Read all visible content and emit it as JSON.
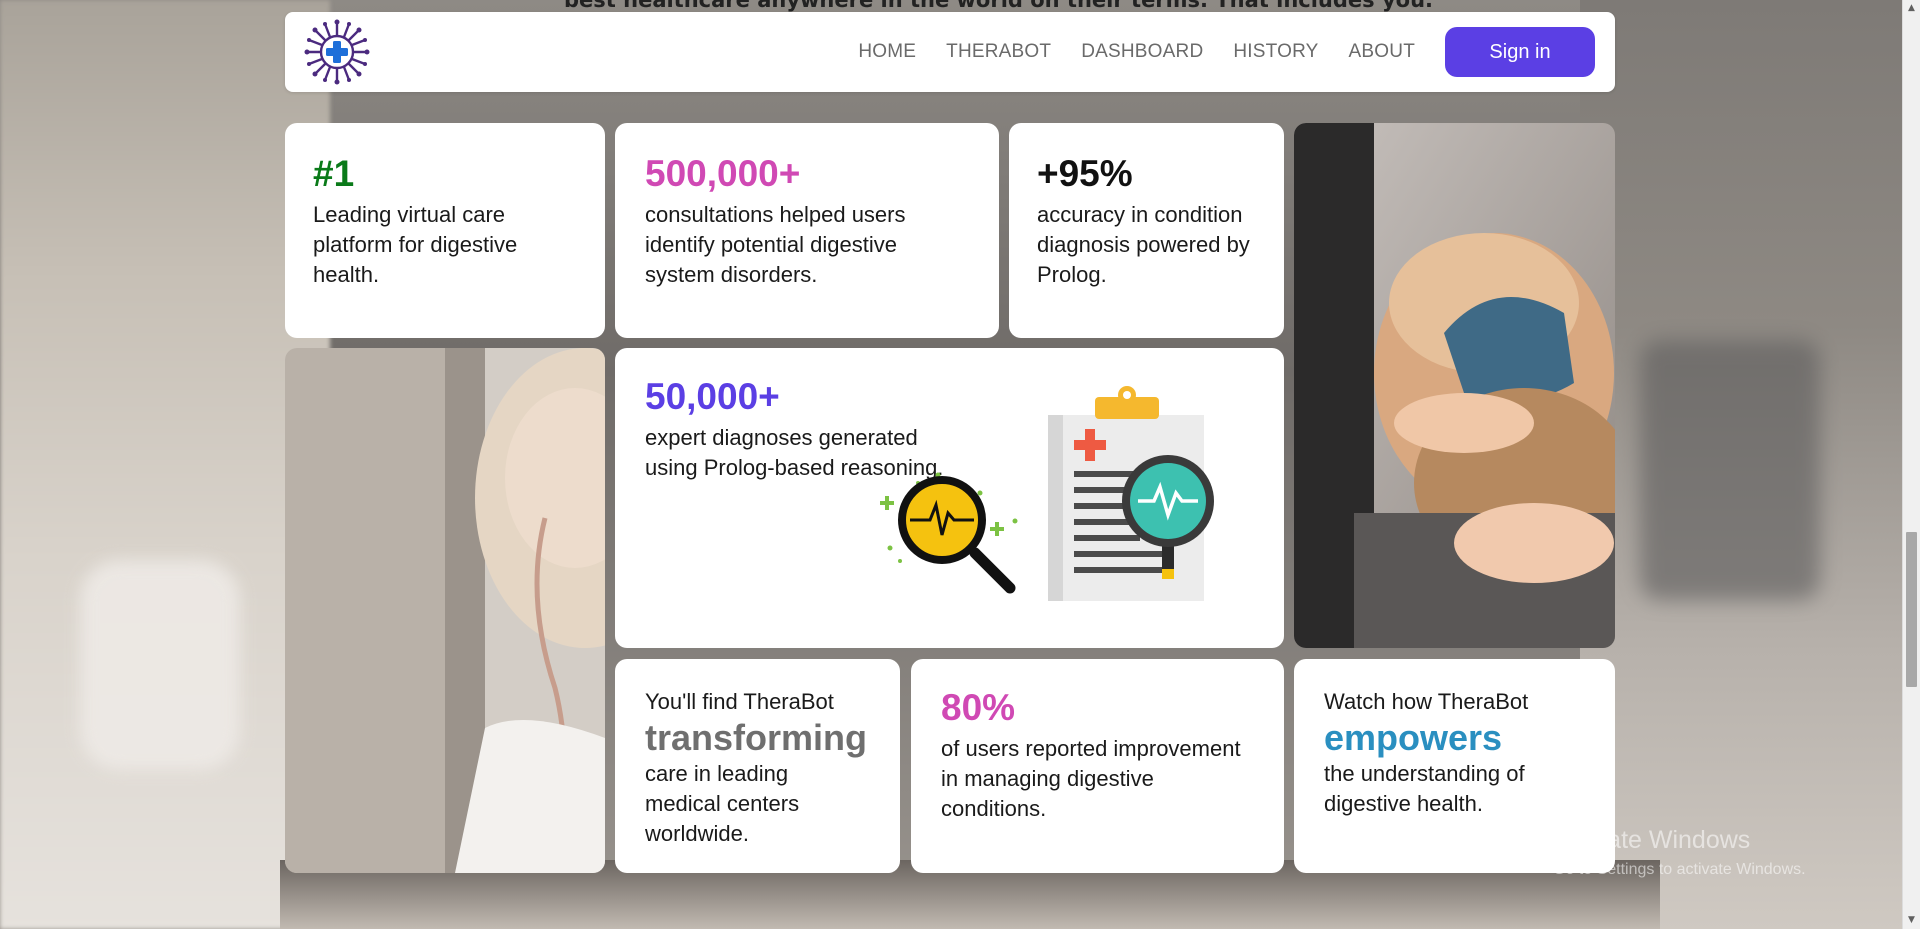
{
  "background_text": "best healthcare anywhere in the world on their terms. That includes you.",
  "nav": {
    "links": [
      "HOME",
      "THERABOT",
      "DASHBOARD",
      "HISTORY",
      "ABOUT"
    ],
    "signin_label": "Sign in",
    "accent": "#5b3fe4"
  },
  "stats": {
    "s1": {
      "value": "#1",
      "desc": "Leading virtual care platform for digestive health.",
      "color": "#0a7a19"
    },
    "s2": {
      "value": "500,000+",
      "desc": "consultations helped users identify potential digestive system disorders.",
      "color": "#d049b4"
    },
    "s3": {
      "value": "+95%",
      "desc": "accuracy in condition diagnosis powered by Prolog.",
      "color": "#111111"
    },
    "s4": {
      "value": "50,000+",
      "desc": "expert diagnoses generated using Prolog-based reasoning.",
      "color": "#5b3fe4"
    },
    "s5": {
      "intro": "You'll find TheraBot",
      "highlight": "transforming",
      "desc": "care in leading medical centers worldwide.",
      "color": "#6f6f6f"
    },
    "s6": {
      "value": "80%",
      "desc": "of users reported improvement in managing digestive conditions.",
      "color": "#d049b4"
    },
    "s7": {
      "intro": "Watch how TheraBot",
      "highlight": "empowers",
      "desc": "the understanding of digestive health.",
      "color": "#2a8fc0"
    }
  },
  "watermark": {
    "title": "Activate Windows",
    "subtitle": "Go to Settings to activate Windows."
  }
}
